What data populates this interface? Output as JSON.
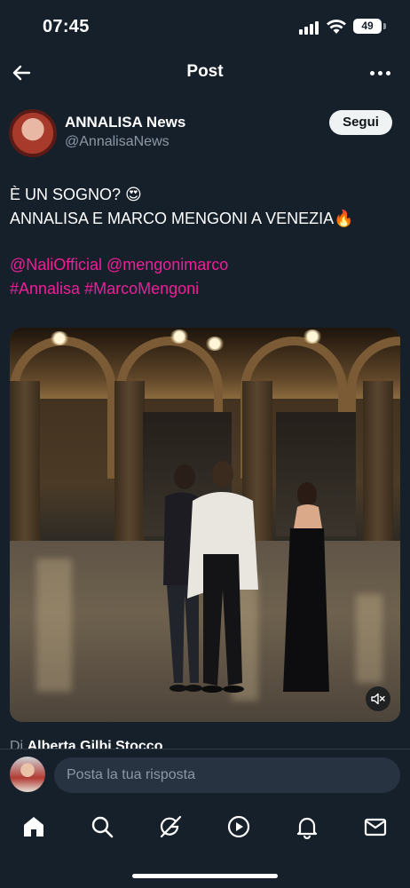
{
  "status_bar": {
    "time": "07:45",
    "battery": "49"
  },
  "header": {
    "title": "Post"
  },
  "author": {
    "name": "ANNALISA News",
    "handle": "@AnnalisaNews",
    "follow_label": "Segui"
  },
  "tweet": {
    "line1": "È UN SOGNO? 😍",
    "line2": "ANNALISA E MARCO MENGONI A VENEZIA🔥",
    "mentions": [
      "@NaliOfficial",
      "@mengonimarco"
    ],
    "hashtags": [
      "#Annalisa",
      "#MarcoMengoni"
    ]
  },
  "credit": {
    "prefix": "Di",
    "name": "Alberta Gilbi Stocco"
  },
  "reply": {
    "placeholder": "Posta la tua risposta"
  },
  "icons": {
    "back": "back-arrow-icon",
    "more": "more-dots-icon",
    "mute": "speaker-muted-icon",
    "tabs": [
      "home-icon",
      "search-icon",
      "grok-icon",
      "video-icon",
      "bell-icon",
      "mail-icon"
    ]
  },
  "colors": {
    "background": "#15202b",
    "link": "#f01e97",
    "muted_text": "#8b98a5"
  }
}
